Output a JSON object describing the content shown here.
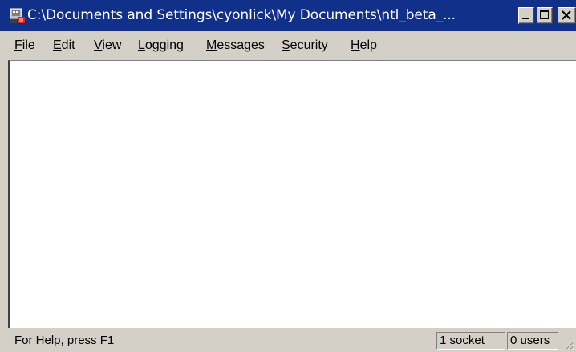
{
  "window": {
    "title": "C:\\Documents and Settings\\cyonlick\\My Documents\\ntl_beta_...",
    "icon": "app-icon"
  },
  "menu": [
    {
      "pre": "",
      "ul": "F",
      "post": "ile"
    },
    {
      "pre": "",
      "ul": "E",
      "post": "dit"
    },
    {
      "pre": "",
      "ul": "V",
      "post": "iew"
    },
    {
      "pre": "",
      "ul": "L",
      "post": "ogging"
    },
    {
      "pre": "",
      "ul": "M",
      "post": "essages"
    },
    {
      "pre": "",
      "ul": "S",
      "post": "ecurity"
    },
    {
      "pre": "",
      "ul": "H",
      "post": "elp"
    }
  ],
  "statusbar": {
    "help_text": "For Help, press F1",
    "sockets": "1 socket",
    "users": "0 users"
  },
  "colors": {
    "titlebar": "#10308a",
    "face": "#d4d0c8",
    "client": "#ffffff"
  }
}
